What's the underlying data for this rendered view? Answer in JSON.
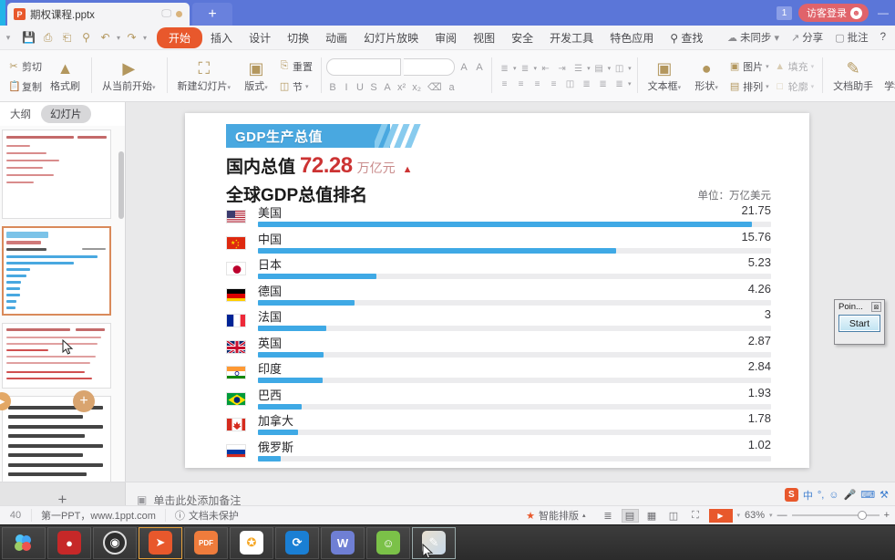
{
  "titlebar": {
    "tab_label": "期权课程.pptx",
    "tab_icon": "P",
    "new_tab_label": "+",
    "badge": "1",
    "login_label": "访客登录",
    "minimize": "—"
  },
  "menubar": {
    "quick_icons": [
      "save-icon",
      "print-icon",
      "save-as-icon",
      "preview-icon",
      "undo-icon",
      "redo-icon",
      "customize-icon"
    ],
    "items": [
      {
        "label": "开始",
        "active": true
      },
      {
        "label": "插入",
        "active": false
      },
      {
        "label": "设计",
        "active": false
      },
      {
        "label": "切换",
        "active": false
      },
      {
        "label": "动画",
        "active": false
      },
      {
        "label": "幻灯片放映",
        "active": false
      },
      {
        "label": "审阅",
        "active": false
      },
      {
        "label": "视图",
        "active": false
      },
      {
        "label": "安全",
        "active": false
      },
      {
        "label": "开发工具",
        "active": false
      },
      {
        "label": "特色应用",
        "active": false
      },
      {
        "label": "查找",
        "active": false
      }
    ],
    "right_items": [
      {
        "label": "未同步",
        "icon": "cloud-icon"
      },
      {
        "label": "分享",
        "icon": "share-icon"
      },
      {
        "label": "批注",
        "icon": "comment-icon"
      },
      {
        "label": "?",
        "icon": "help-icon"
      }
    ]
  },
  "ribbon": {
    "clipboard": [
      {
        "label": "剪切",
        "icon": "scissors-icon"
      },
      {
        "label": "复制",
        "icon": "copy-icon"
      }
    ],
    "format_painter": {
      "label": "格式刷",
      "icon": "paintbrush-icon"
    },
    "start_show": {
      "label": "从当前开始",
      "icon": "play-circle-icon"
    },
    "slides": [
      {
        "label": "新建幻灯片",
        "icon": "new-slide-icon"
      },
      {
        "label": "版式",
        "icon": "layout-icon"
      },
      {
        "label": "节",
        "icon": "section-icon"
      }
    ],
    "reset": {
      "label": "重置",
      "icon": "reset-icon"
    },
    "font": {
      "family_value": "",
      "size_value": "",
      "grow_label": "A",
      "shrink_label": "A",
      "buttons": [
        "B",
        "I",
        "U",
        "S",
        "A",
        "x²",
        "x₂",
        "⌫",
        "a"
      ]
    },
    "paragraph": {
      "buttons": [
        "bullets-icon",
        "numbering-icon",
        "decrease-indent-icon",
        "increase-indent-icon",
        "text-direction-icon",
        "align-text-icon",
        "columns-icon",
        "align-left-icon",
        "align-center-icon",
        "align-right-icon",
        "justify-icon",
        "distribute-icon",
        "line-spacing-icon",
        "list-level-icon",
        "paragraph-spacing-icon"
      ]
    },
    "insert": [
      {
        "label": "文本框",
        "icon": "textbox-icon"
      },
      {
        "label": "形状",
        "icon": "shapes-icon"
      },
      {
        "label": "图片",
        "icon": "picture-icon"
      },
      {
        "label": "排列",
        "icon": "arrange-icon"
      },
      {
        "label": "填充",
        "icon": "fill-icon"
      },
      {
        "label": "轮廓",
        "icon": "outline-icon"
      }
    ],
    "assistants": [
      {
        "label": "文档助手",
        "icon": "doc-assistant-icon"
      },
      {
        "label": "学科助手",
        "icon": "subject-assistant-icon"
      }
    ]
  },
  "leftpanel": {
    "tabs": [
      {
        "label": "大纲",
        "selected": false
      },
      {
        "label": "幻灯片",
        "selected": true
      }
    ]
  },
  "slide": {
    "band_title": "GDP生产总值",
    "subtitle_key": "国内总值",
    "subtitle_value": "72.28",
    "subtitle_unit": "万亿元",
    "subtitle_arrow": "▲",
    "title": "全球GDP总值排名",
    "unit_note": "单位：万亿美元"
  },
  "chart_data": {
    "type": "bar",
    "title": "全球GDP总值排名",
    "xlabel": "",
    "ylabel": "",
    "unit": "单位：万亿美元",
    "orientation": "horizontal",
    "grid": false,
    "legend": false,
    "xlim": [
      0,
      22.6
    ],
    "categories": [
      "美国",
      "中国",
      "日本",
      "德国",
      "法国",
      "英国",
      "印度",
      "巴西",
      "加拿大",
      "俄罗斯"
    ],
    "values": [
      21.75,
      15.76,
      5.23,
      4.26,
      3,
      2.87,
      2.84,
      1.93,
      1.78,
      1.02
    ],
    "value_labels": [
      "21.75",
      "15.76",
      "5.23",
      "4.26",
      "3",
      "2.87",
      "2.84",
      "1.93",
      "1.78",
      "1.02"
    ],
    "flags": [
      "us-flag",
      "cn-flag",
      "jp-flag",
      "de-flag",
      "fr-flag",
      "gb-flag",
      "in-flag",
      "br-flag",
      "ca-flag",
      "ru-flag"
    ],
    "bar_color": "#3fa9e5",
    "track_color": "#ececee"
  },
  "float_window": {
    "title": "Poin...",
    "close_label": "⊠",
    "start_label": "Start"
  },
  "notes": {
    "add_label": "+",
    "placeholder": "单击此处添加备注"
  },
  "status": {
    "slide_number": "40",
    "source": "第一PPT，www.1ppt.com",
    "protection": "文档未保护",
    "smart_layout": "智能排版",
    "zoom": "63%",
    "view_buttons": [
      "normal-view-icon",
      "slide-sorter-icon",
      "reading-view-icon",
      "notes-view-icon"
    ],
    "play_label": "▶",
    "zoom_out": "—",
    "zoom_in": "+"
  },
  "ime": {
    "logo": "S",
    "mode": "中",
    "items": [
      "punctuation-icon",
      "emoji-icon",
      "mic-icon",
      "keyboard-icon",
      "tools-icon"
    ]
  },
  "taskbar": {
    "items": [
      "start-icon",
      "bank-icon",
      "obs-icon",
      "flash-icon",
      "pdf-icon",
      "kuaishou-icon",
      "sogou-icon",
      "wps-icon",
      "wechat-icon",
      "paint-icon"
    ]
  },
  "colors": {
    "accent": "#e8582c",
    "titlebar": "#5b76d8",
    "bar": "#3fa9e5",
    "band": "#49a8e0",
    "value_red": "#cc3333"
  }
}
